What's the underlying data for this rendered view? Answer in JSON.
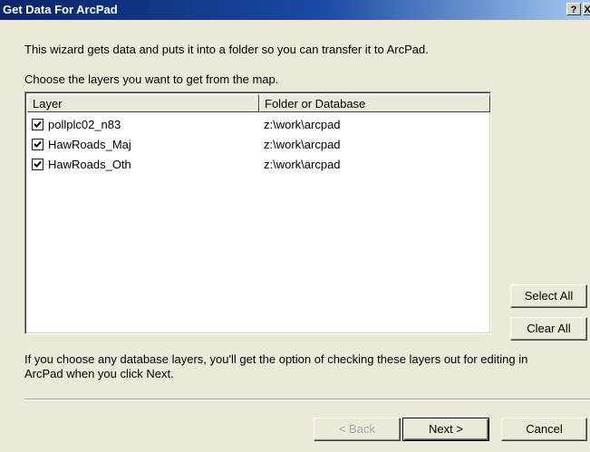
{
  "window": {
    "title": "Get Data For ArcPad",
    "help_label": "?",
    "close_label": "X"
  },
  "intro_text": "This wizard gets data and puts it into a folder so you can transfer it to ArcPad.",
  "choose_text": "Choose the layers you want to get from the map.",
  "list": {
    "columns": [
      "Layer",
      "Folder or Database"
    ],
    "rows": [
      {
        "checked": true,
        "layer": "pollplc02_n83",
        "folder": "z:\\work\\arcpad"
      },
      {
        "checked": true,
        "layer": "HawRoads_Maj",
        "folder": "z:\\work\\arcpad"
      },
      {
        "checked": true,
        "layer": "HawRoads_Oth",
        "folder": "z:\\work\\arcpad"
      }
    ]
  },
  "buttons": {
    "select_all": "Select All",
    "clear_all": "Clear All",
    "back": "< Back",
    "next": "Next >",
    "cancel": "Cancel"
  },
  "info_text_line1": "If you choose any database layers, you'll get the option of checking these layers out for editing in",
  "info_text_line2": "ArcPad when you click Next."
}
